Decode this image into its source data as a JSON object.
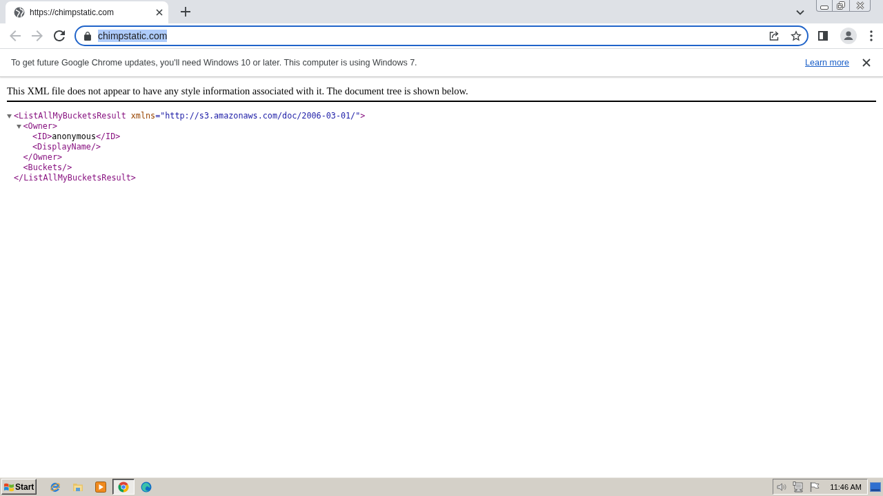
{
  "tabs": [
    {
      "title": "https://chimpstatic.com",
      "selected": true
    }
  ],
  "navigation": [
    {
      "kind": "back",
      "disabled": true
    },
    {
      "kind": "forward",
      "disabled": true
    },
    {
      "kind": "reload",
      "disabled": false
    }
  ],
  "omnibox": {
    "value": "chimpstatic.com",
    "selected": true
  },
  "infobar": {
    "message": "To get future Google Chrome updates, you'll need Windows 10 or later. This computer is using Windows 7.",
    "link": "Learn more"
  },
  "xml_viewer": {
    "notice": "This XML file does not appear to have any style information associated with it. The document tree is shown below.",
    "tree": [
      {
        "expanded": true,
        "start": [
          {
            "kind": "tag",
            "text": "<ListAllMyBucketsResult"
          },
          {
            "kind": "attr",
            "text": "xmlns"
          },
          {
            "kind": "value",
            "text": "=\"http://s3.amazonaws.com/doc/2006-03-01/\""
          },
          {
            "kind": "tag",
            "text": ">"
          }
        ],
        "children": [
          {
            "expanded": true,
            "start": [
              {
                "kind": "tag",
                "text": "<Owner>"
              }
            ],
            "children": [
              {
                "line": [
                  {
                    "kind": "tag",
                    "text": "<ID>"
                  },
                  {
                    "kind": "text",
                    "text": "anonymous"
                  },
                  {
                    "kind": "tag",
                    "text": "</ID>"
                  }
                ]
              },
              {
                "line": [
                  {
                    "kind": "tag",
                    "text": "<DisplayName/>"
                  }
                ]
              }
            ],
            "end": [
              {
                "kind": "tag",
                "text": "</Owner>"
              }
            ]
          },
          {
            "line": [
              {
                "kind": "tag",
                "text": "<Buckets/>"
              }
            ]
          }
        ],
        "end": [
          {
            "kind": "tag",
            "text": "</ListAllMyBucketsResult>"
          }
        ]
      }
    ]
  },
  "taskbar": {
    "start": "Start",
    "apps": [
      {
        "kind": "ie",
        "selected": false
      },
      {
        "kind": "folder",
        "selected": false
      },
      {
        "kind": "player",
        "selected": false
      },
      {
        "kind": "chrome",
        "selected": true
      },
      {
        "kind": "edge",
        "selected": false
      }
    ],
    "clock": "11:46 AM"
  }
}
